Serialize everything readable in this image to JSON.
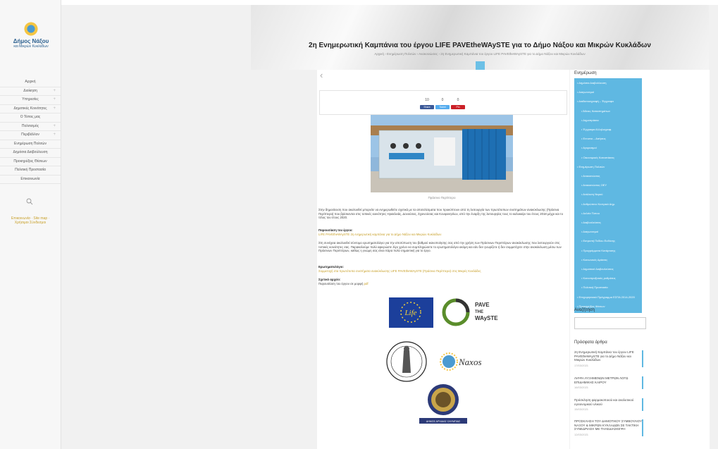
{
  "site": {
    "name": "Δήμος Νάξου",
    "subtitle": "και Μικρών Κυκλάδων"
  },
  "nav": [
    {
      "label": "Αρχική",
      "has_sub": false
    },
    {
      "label": "Διοίκηση",
      "has_sub": true
    },
    {
      "label": "Υπηρεσίες",
      "has_sub": true
    },
    {
      "label": "Δημοτικές Κοινότητες",
      "has_sub": true
    },
    {
      "label": "Ο Τόπος μας",
      "has_sub": false
    },
    {
      "label": "Πολιτισμός",
      "has_sub": true
    },
    {
      "label": "Περιβάλλον",
      "has_sub": true
    },
    {
      "label": "Ενημέρωση Πολιτών",
      "has_sub": false
    },
    {
      "label": "Δημόσια Διαβούλευση",
      "has_sub": false
    },
    {
      "label": "Προκηρύξεις Θέσεων",
      "has_sub": false
    },
    {
      "label": "Πολιτική Προστασία",
      "has_sub": false
    },
    {
      "label": "Επικοινωνία",
      "has_sub": false
    }
  ],
  "footer_links": "Επικοινωνία · Site map · Χρήσιμοι Σύνδεσμοι",
  "page": {
    "title": "2η Ενημερωτική Καμπάνια του έργου LIFE PAVEtheWAySTE για το Δήμο Νάξου και Μικρών Κυκλάδων",
    "breadcrumb": "Αρχική  ›  Ενημέρωση Πολιτών  ›  Ανακοινώσεις  ›  2η Ενημερωτική Καμπάνια του έργου LIFE PAVEtheWAySTE για το Δήμο Νάξου και Μικρών Κυκλάδων"
  },
  "share": {
    "counts": [
      "10",
      "0",
      "0"
    ],
    "buttons": [
      "Share",
      "Tweet",
      "Pin"
    ]
  },
  "photo": {
    "caption": "Πράσινο Περίπτερο"
  },
  "article": {
    "intro": "Στην δημοσίευση που ακολουθεί μπορείτε να ενημερωθείτε σχετικά με τα αποτελέσματα που προκύπτουν από τη λειτουργία των πρωτότυπων συστημάτων ανακύκλωσης (Πράσινα Περίπτερα) που βρίσκονται στις τοπικές κοινότητες Ηρακλειάς, Δονούσας, Σχοινούσας και Κουφονησίων, από την έναρξη της λειτουργίας τους το καλοκαίρι του έτους 2018 μέχρι και το τέλος του έτους 2020.",
    "h1": "Παρουσίαση του έργου:",
    "l1": "LIFE PAVEtheWAySTE 2η ενημερωτική καμπάνια για το Δήμο Νάξου και Μικρών Κυκλάδων",
    "p2": "Στη συνέχεια ακολουθεί σύντομο ερωτηματολόγιο για την αποτύπωση του βαθμού ικανοποίησης σας από την χρήση των Πράσινων Περιπτέρων ανακύκλωσης που λειτουργούν στις τοπικές κοινότητες σας. Παρακαλούμε πολύ αφιερώστε λίγο χρόνο να συμπληρώσετε το ερωτηματολόγιο ακόμη και εάν δεν γνωρίζετε ή δεν συμμετέχετε στην ανακύκλωση μέσω των Πράσινων Περιπτέρων, καθώς η γνώμη σας είναι πάρα πολύ σημαντική για το έργο.",
    "h2": "Ερωτηματολόγιο:",
    "l2": "Συμμετοχή στα πρωτότυπα συστήματα ανακύκλωσης LIFE PAVEtheWAySTE (Πράσινα Περίπτερα) στις Μικρές Κυκλάδες",
    "h3": "Σχετικό αρχείο:",
    "p3": "Παρουσίαση του έργου σε μορφή",
    "pdf": "pdf"
  },
  "logos": {
    "pave1": "PAVE",
    "pave2": "THE",
    "pave3": "WAySTE",
    "life": "Life",
    "naxos": "Νaxos",
    "archaia": "ΔΗΜΟΣ ΑΡΧΑΙΑΣ ΟΛΥΜΠΙΑΣ"
  },
  "sidebar_right": {
    "title": "Ενημέρωση",
    "items": [
      {
        "label": "Δημόσια Διαβούλευση",
        "level": 0
      },
      {
        "label": "Διαγωνισμοί",
        "level": 0
      },
      {
        "label": "Διαδικτυογραφή – Έγγραφα",
        "level": 0
      },
      {
        "label": "Άδειες Καταστημάτων",
        "level": 1
      },
      {
        "label": "Δημοπράσια",
        "level": 1
      },
      {
        "label": "Έγγραφα Αλληλογραφ.",
        "level": 1
      },
      {
        "label": "Εντυπα – Αιτήσεις",
        "level": 1
      },
      {
        "label": "Αγορασμοί",
        "level": 1
      },
      {
        "label": "Οικονομικές Καταστάσεις",
        "level": 1
      },
      {
        "label": "Ενημέρωση Πολιτών",
        "level": 0
      },
      {
        "label": "Ανακοινώσεις",
        "level": 1
      },
      {
        "label": "Ανακοινώσεις ΟΕΥ",
        "level": 1
      },
      {
        "label": "Ανάλυση Νερού",
        "level": 1
      },
      {
        "label": "Ανθρώπινο Κεντρικό Δημ.",
        "level": 1
      },
      {
        "label": "Δελτία Τύπου",
        "level": 1
      },
      {
        "label": "Διαβουλεύσεις",
        "level": 1
      },
      {
        "label": "Διαγωνισμοί",
        "level": 1
      },
      {
        "label": "Εκτροπή Πεδίου Ευθύνης",
        "level": 1
      },
      {
        "label": "Προγράμματα Κατάρτισης",
        "level": 1
      },
      {
        "label": "Κοινωνικές Δράσεις",
        "level": 1
      },
      {
        "label": "Δημοτικοί Διαβουλεύσεις",
        "level": 1
      },
      {
        "label": "Κοινοπραξιακές ρυθμίσεις",
        "level": 1
      },
      {
        "label": "Πολιτική Προστασία",
        "level": 1
      },
      {
        "label": "Επιχειρησιακό Πρόγραμμα ΕΣΠΑ 2014-2020",
        "level": 0
      },
      {
        "label": "Προκηρύξεις θέσεων",
        "level": 0
      }
    ]
  },
  "search": {
    "title": "Αναζήτηση",
    "placeholder": ""
  },
  "recent": {
    "title": "Πρόσφατα άρθρα",
    "items": [
      {
        "title": "2η Ενημερωτική Καμπάνια του έργου LIFE PAVEtheWAySTE για το Δήμο Νάξου και Μικρών Κυκλάδων",
        "date": "17/03/2021"
      },
      {
        "title": "ΛΗΨΗ ΑΥΞΗΜΕΝΩΝ ΜΕΤΡΩΝ ΛΟΓΩ ΕΠΙΔΗΜΙΚΗΣ ΚΑΙΡΟΥ",
        "date": "16/03/2021"
      },
      {
        "title": "Πρόσκληση φαρμακοποιού και αναλυτικού υγειονομικού υλικού",
        "date": "15/03/2021"
      },
      {
        "title": "ΠΡΟΣΚΛΗΣΗ ΤΟΥ ΔΗΜΟΤΙΚΟΥ ΣΥΜΒΟΥΛΙΟΥ ΝΑΞΟΥ & ΜΙΚΡΩΝ ΚΥΚΛΑΔΩΝ ΣΕ ΤΑΚΤΙΚΗ ΣΥΝΕΔΡΙΑΣΗ ΜΕ ΤΗΛΕΔΙΑΣΚΕΨΗ",
        "date": "12/03/2021"
      }
    ]
  }
}
